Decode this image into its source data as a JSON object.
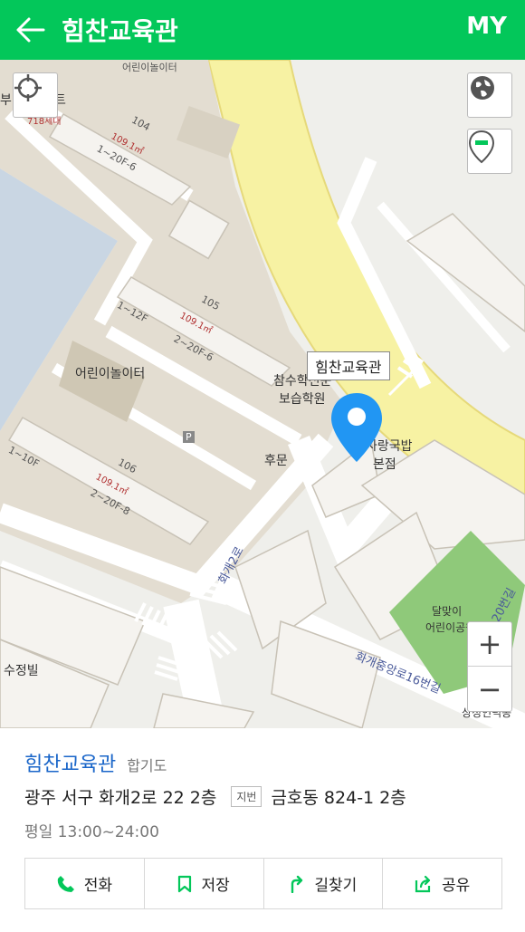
{
  "header": {
    "title": "힘찬교육관",
    "my_label": "MY"
  },
  "map": {
    "labels": {
      "playground_top": "어린이놀이터",
      "apartment_partial": "부",
      "apartment_partial2": "트",
      "units_top": "718세대",
      "bldg_104": "104",
      "area_104": "109.1㎡",
      "floors_104": "1~20F-6",
      "bldg_105": "105",
      "floors_105a": "1~12F",
      "area_105": "109.1㎡",
      "floors_105b": "2~20F-6",
      "playground_mid": "어린이놀이터",
      "parking": "P",
      "floors_106a": "1~10F",
      "bldg_106": "106",
      "area_106": "109.1㎡",
      "floors_106b": "2~20F-8",
      "back_gate": "후문",
      "academy_line1": "참수학전문",
      "academy_line2": "보습학원",
      "gukbap_line1": "사랑국밥",
      "gukbap_line2": "본점",
      "street_hwagae2": "화개2로",
      "park_line1": "달맞이",
      "park_line2": "어린이공원",
      "street_20": "20번길",
      "street_16": "화개중앙로16번길",
      "villa": "수정빌",
      "bottom_right": "상정인덕콩"
    },
    "place_tag": "힘찬교육관",
    "zoom_in": "+",
    "zoom_out": "−"
  },
  "place": {
    "name": "힘찬교육관",
    "category": "합기도",
    "address": "광주 서구 화개2로 22 2층",
    "jibun_label": "지번",
    "jibun_address": "금호동 824-1 2층",
    "hours": "평일 13:00~24:00"
  },
  "actions": [
    {
      "label": "전화",
      "icon": "phone-icon"
    },
    {
      "label": "저장",
      "icon": "bookmark-icon"
    },
    {
      "label": "길찾기",
      "icon": "directions-icon"
    },
    {
      "label": "공유",
      "icon": "share-icon"
    }
  ],
  "colors": {
    "brand_green": "#03c75a",
    "place_blue": "#1a66c9",
    "marker_blue": "#2196f3",
    "park_green": "#8fc97a",
    "road_yellow": "#f7f2a3"
  }
}
